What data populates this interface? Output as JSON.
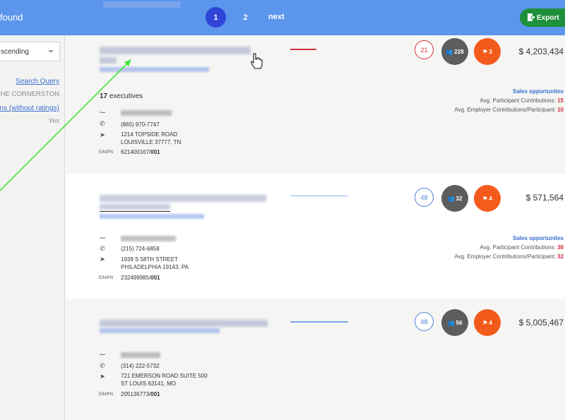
{
  "header": {
    "found_label": "found",
    "pages": [
      "1",
      "2"
    ],
    "next_label": "next",
    "export_label": "Export"
  },
  "sidebar": {
    "sort_value": "scending",
    "search_query_label": "Search Query",
    "search_query_value": "THE CORNERSTON",
    "plans_label": "lans (without ratings)",
    "plans_value": "Yes"
  },
  "cards": [
    {
      "executives_count": "17",
      "executives_label": "executives",
      "phone": "(865) 970-7747",
      "address_line1": "1214 TOPSIDE ROAD",
      "address_line2": "LOUISVILLE 37777, TN",
      "ein_label": "EIN/PN",
      "ein_number": "621400167/",
      "plan_number": "001",
      "score": "21",
      "participants": "228",
      "flags": "3",
      "amount": "$ 4,203,434",
      "sales_title": "Sales opportunites",
      "participant_label": "Avg. Participant Contributions:",
      "participant_value": "15",
      "employer_label": "Avg. Employer Contributions/Participant:",
      "employer_value": "10"
    },
    {
      "phone": "(215) 724-6858",
      "address_line1": "1939 S 58TH STREET",
      "address_line2": "PHILADELPHIA 19143, PA",
      "ein_label": "EIN/PN",
      "ein_number": "232499985/",
      "plan_number": "001",
      "score": "48",
      "participants": "32",
      "flags": "4",
      "amount": "$ 571,564",
      "sales_title": "Sales opportunites",
      "participant_label": "Avg. Participant Contributions:",
      "participant_value": "38",
      "employer_label": "Avg. Employer Contributions/Participant:",
      "employer_value": "32"
    },
    {
      "phone": "(314) 222-5732",
      "address_line1": "721 EMERSON ROAD SUITE 500",
      "address_line2": "ST LOUIS 63141, MO",
      "ein_label": "EIN/PN",
      "ein_number": "205136773/",
      "plan_number": "001",
      "score": "48",
      "participants": "56",
      "flags": "4",
      "amount": "$ 5,005,467"
    }
  ],
  "colors": {
    "header_bg": "#5b95ec",
    "page_active": "#2f45d8",
    "export_green": "#1e8f3a",
    "score_red": "#d23141",
    "score_blue": "#4a7fd8",
    "pill_gray": "#5d5d5d",
    "pill_orange": "#f35b1c",
    "link_blue": "#3a6fd0",
    "annotation_arrow": "#3ee63a"
  },
  "icons": {
    "exec": "pulse-icon",
    "phone": "phone-icon",
    "location": "location-arrow-icon",
    "participants": "users-icon",
    "flags": "flag-icon",
    "export": "export-icon",
    "cursor": "hand-pointer-cursor"
  }
}
